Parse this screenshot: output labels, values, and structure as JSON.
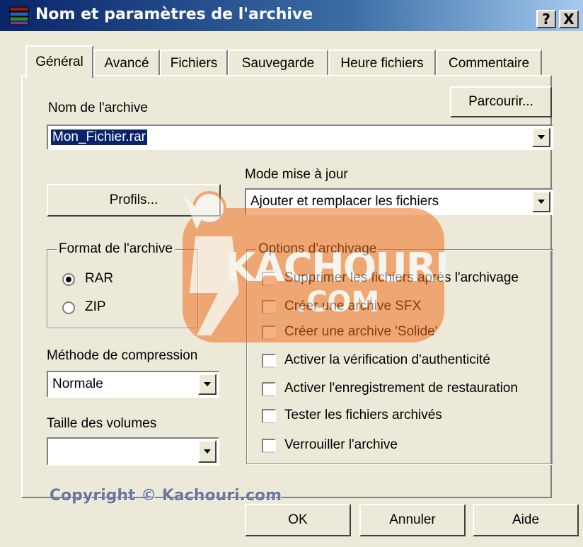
{
  "window": {
    "title": "Nom et paramètres de l'archive",
    "help_label": "?",
    "close_label": "X"
  },
  "tabs": [
    {
      "label": "Général",
      "active": true
    },
    {
      "label": "Avancé",
      "active": false
    },
    {
      "label": "Fichiers",
      "active": false
    },
    {
      "label": "Sauvegarde",
      "active": false
    },
    {
      "label": "Heure fichiers",
      "active": false
    },
    {
      "label": "Commentaire",
      "active": false
    }
  ],
  "general": {
    "archive_name_label": "Nom de l'archive",
    "browse_button": "Parcourir...",
    "archive_name_value": "Mon_Fichier.rar",
    "profiles_button": "Profils...",
    "update_mode_label": "Mode mise à jour",
    "update_mode_value": "Ajouter et remplacer les fichiers",
    "format_group_title": "Format de l'archive",
    "format_options": [
      {
        "label": "RAR",
        "selected": true
      },
      {
        "label": "ZIP",
        "selected": false
      }
    ],
    "compression_label": "Méthode de compression",
    "compression_value": "Normale",
    "volume_size_label": "Taille des volumes",
    "volume_size_value": "",
    "options_group_title": "Options d'archivage",
    "options": [
      {
        "label": "Supprimer les fichiers après l'archivage",
        "checked": false
      },
      {
        "label": "Créer une archive SFX",
        "checked": false
      },
      {
        "label": "Créer une archive 'Solide'",
        "checked": false
      },
      {
        "label": "Activer la vérification d'authenticité",
        "checked": false
      },
      {
        "label": "Activer l'enregistrement de restauration",
        "checked": false
      },
      {
        "label": "Tester les fichiers archivés",
        "checked": false
      },
      {
        "label": "Verrouiller l'archive",
        "checked": false
      }
    ]
  },
  "footer": {
    "copyright": "Copyright © Kachouri.com",
    "ok_button": "OK",
    "cancel_button": "Annuler",
    "help_button": "Aide"
  },
  "watermark": {
    "text": "KACHOURI",
    "subtext": ".COM",
    "color": "#f07020"
  }
}
